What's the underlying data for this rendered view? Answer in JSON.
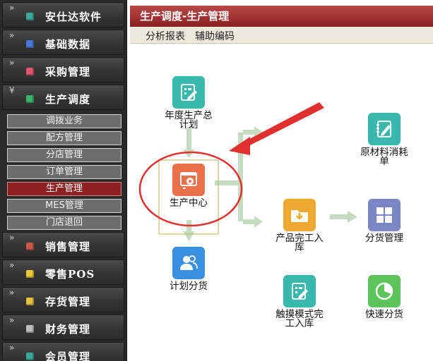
{
  "sidebar": {
    "categories": [
      {
        "label": "安仕达软件",
        "chevron": "»",
        "icon_color": "#3aa79a"
      },
      {
        "label": "基础数据",
        "chevron": "»",
        "icon_color": "#4a78d8"
      },
      {
        "label": "采购管理",
        "chevron": "»",
        "icon_color": "#e0566e"
      },
      {
        "label": "生产调度",
        "chevron": "¥",
        "icon_color": "#38b56a"
      },
      {
        "label": "销售管理",
        "chevron": "»",
        "icon_color": "#c9584a"
      },
      {
        "label": "零售POS",
        "chevron": "»",
        "icon_color": "#e8c83a"
      },
      {
        "label": "存货管理",
        "chevron": "»",
        "icon_color": "#e6c040"
      },
      {
        "label": "财务管理",
        "chevron": "»",
        "icon_color": "#bcbcbc"
      },
      {
        "label": "会员管理",
        "chevron": "»",
        "icon_color": "#3aa79a"
      }
    ],
    "submenu": [
      {
        "label": "调拨业务"
      },
      {
        "label": "配方管理"
      },
      {
        "label": "分店管理"
      },
      {
        "label": "订单管理"
      },
      {
        "label": "生产管理"
      },
      {
        "label": "MES管理"
      },
      {
        "label": "门店退回"
      }
    ],
    "active_submenu": "生产管理"
  },
  "header": {
    "title": "生产调度-生产管理"
  },
  "toolbar": {
    "report": "分析报表",
    "aux_code": "辅助编码"
  },
  "flow": {
    "annual_plan": "年度生产总\n计划",
    "production_center": "生产中心",
    "plan_distribution": "计划分货",
    "material_consumption": "原材料消耗\n单",
    "finished_storage": "产品完工入\n库",
    "distribution_mgmt": "分货管理",
    "touch_storage": "触摸模式完\n工入库",
    "quick_distribution": "快速分货"
  },
  "colors": {
    "header_red": "#9c2b2b",
    "teal": "#39b8ae",
    "orange": "#e8704b",
    "blue": "#3b8fe0",
    "yellow": "#f0a830",
    "purple": "#7b86c4",
    "green": "#5cc45a",
    "arrow_green": "#c5dcc0",
    "annotation_red": "#e03030"
  }
}
